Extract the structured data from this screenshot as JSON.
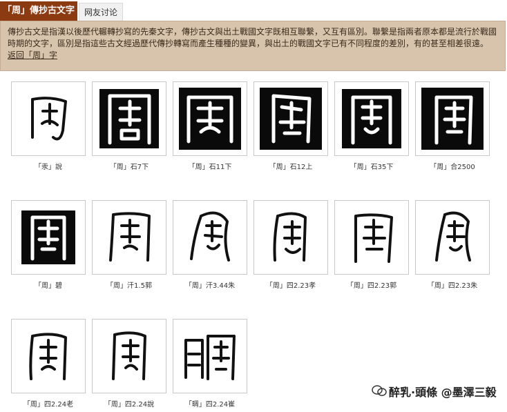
{
  "tabs": {
    "active": "「周」傳抄古文字",
    "inactive": "网友讨论"
  },
  "description": {
    "text": "傳抄古文是指漢以後歷代輾轉抄寫的先秦文字，傳抄古文與出土戰國文字既相互聯繫，又互有區別。聯繫是指兩者原本都是流行於戰國時期的文字，區別是指這些古文經過歷代傳抄轉寫而產生種種的變異，與出土的戰國文字已有不同程度的差別，有的甚至相差很遠。",
    "link": "返回「周」字"
  },
  "items": [
    {
      "caption": "「汞」說"
    },
    {
      "caption": "「周」石7下"
    },
    {
      "caption": "「周」石11下"
    },
    {
      "caption": "「周」石12上"
    },
    {
      "caption": "「周」石35下"
    },
    {
      "caption": "「周」合2500"
    },
    {
      "caption": "「周」碧"
    },
    {
      "caption": "「周」汗1.5郭"
    },
    {
      "caption": "「周」汗3.44朱"
    },
    {
      "caption": "「周」四2.23孝"
    },
    {
      "caption": "「周」四2.23郭"
    },
    {
      "caption": "「周」四2.23朱"
    },
    {
      "caption": "「周」四2.24老"
    },
    {
      "caption": "「周」四2.24說"
    },
    {
      "caption": "「晭」四2.24崔"
    }
  ],
  "watermark": "醉乳·頭條 @墨澤三毅"
}
